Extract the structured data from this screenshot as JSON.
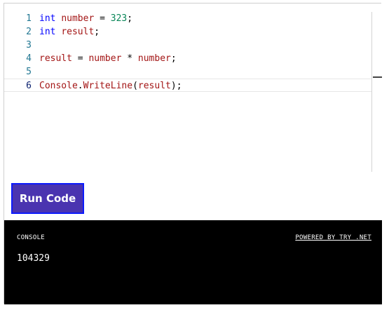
{
  "editor": {
    "lines": [
      {
        "number": "1",
        "tokens": [
          {
            "text": "int",
            "kind": "keyword"
          },
          {
            "text": " ",
            "kind": "plain"
          },
          {
            "text": "number",
            "kind": "ident"
          },
          {
            "text": " = ",
            "kind": "plain"
          },
          {
            "text": "323",
            "kind": "number"
          },
          {
            "text": ";",
            "kind": "plain"
          }
        ]
      },
      {
        "number": "2",
        "tokens": [
          {
            "text": "int",
            "kind": "keyword"
          },
          {
            "text": " ",
            "kind": "plain"
          },
          {
            "text": "result",
            "kind": "ident"
          },
          {
            "text": ";",
            "kind": "plain"
          }
        ]
      },
      {
        "number": "3",
        "tokens": []
      },
      {
        "number": "4",
        "tokens": [
          {
            "text": "result",
            "kind": "ident"
          },
          {
            "text": " = ",
            "kind": "plain"
          },
          {
            "text": "number",
            "kind": "ident"
          },
          {
            "text": " * ",
            "kind": "plain"
          },
          {
            "text": "number",
            "kind": "ident"
          },
          {
            "text": ";",
            "kind": "plain"
          }
        ]
      },
      {
        "number": "5",
        "tokens": []
      },
      {
        "number": "6",
        "current": true,
        "tokens": [
          {
            "text": "Console",
            "kind": "ident"
          },
          {
            "text": ".",
            "kind": "plain"
          },
          {
            "text": "WriteLine",
            "kind": "ident"
          },
          {
            "text": "(",
            "kind": "plain"
          },
          {
            "text": "result",
            "kind": "ident"
          },
          {
            "text": ");",
            "kind": "plain"
          }
        ]
      }
    ]
  },
  "toolbar": {
    "run_label": "Run Code"
  },
  "console": {
    "title": "CONSOLE",
    "powered_by": "POWERED BY TRY .NET",
    "output": "104329"
  },
  "colors": {
    "keyword": "#0000ff",
    "identifier": "#a31515",
    "number": "#098658",
    "line_number": "#237893",
    "run_button_bg": "#4a34b0",
    "run_button_border": "#0d1bff",
    "console_bg": "#000000"
  }
}
